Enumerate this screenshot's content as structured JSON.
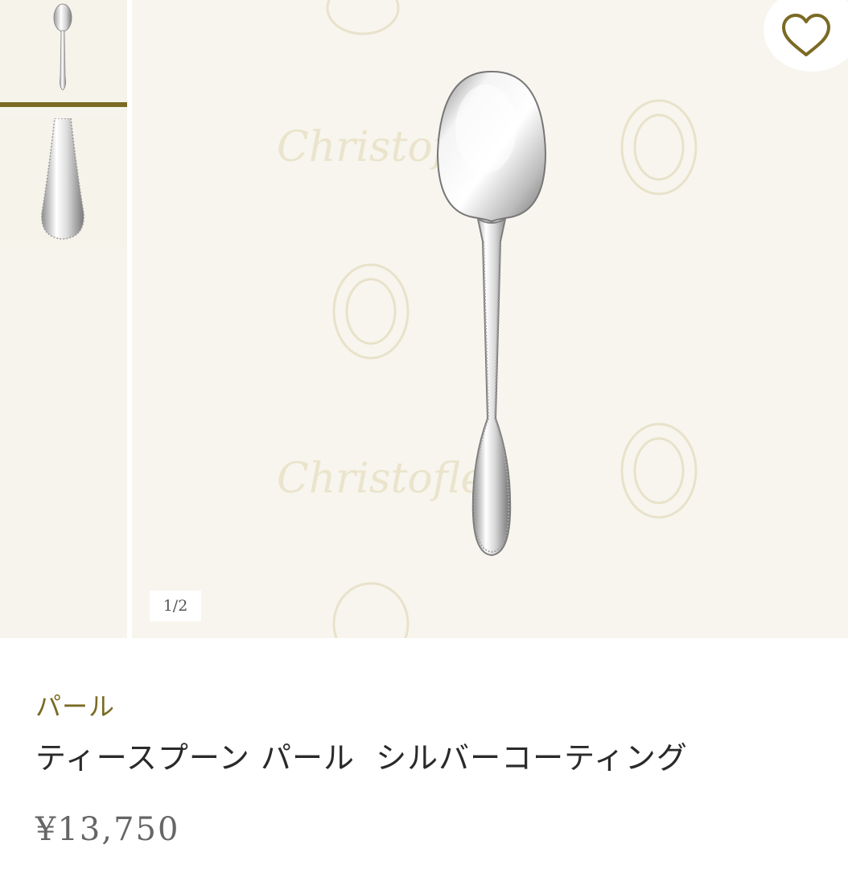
{
  "gallery": {
    "counter": "1/2",
    "thumbnails": [
      {
        "name": "spoon-full-view",
        "active": true
      },
      {
        "name": "spoon-handle-detail",
        "active": false
      }
    ],
    "watermark_text": "Christofle",
    "accent_color": "#7b6a24"
  },
  "favorite": {
    "icon": "heart-outline-icon"
  },
  "product": {
    "collection": "パール",
    "name": "ティースプーン パール  シルバーコーティング",
    "price": "¥13,750"
  }
}
